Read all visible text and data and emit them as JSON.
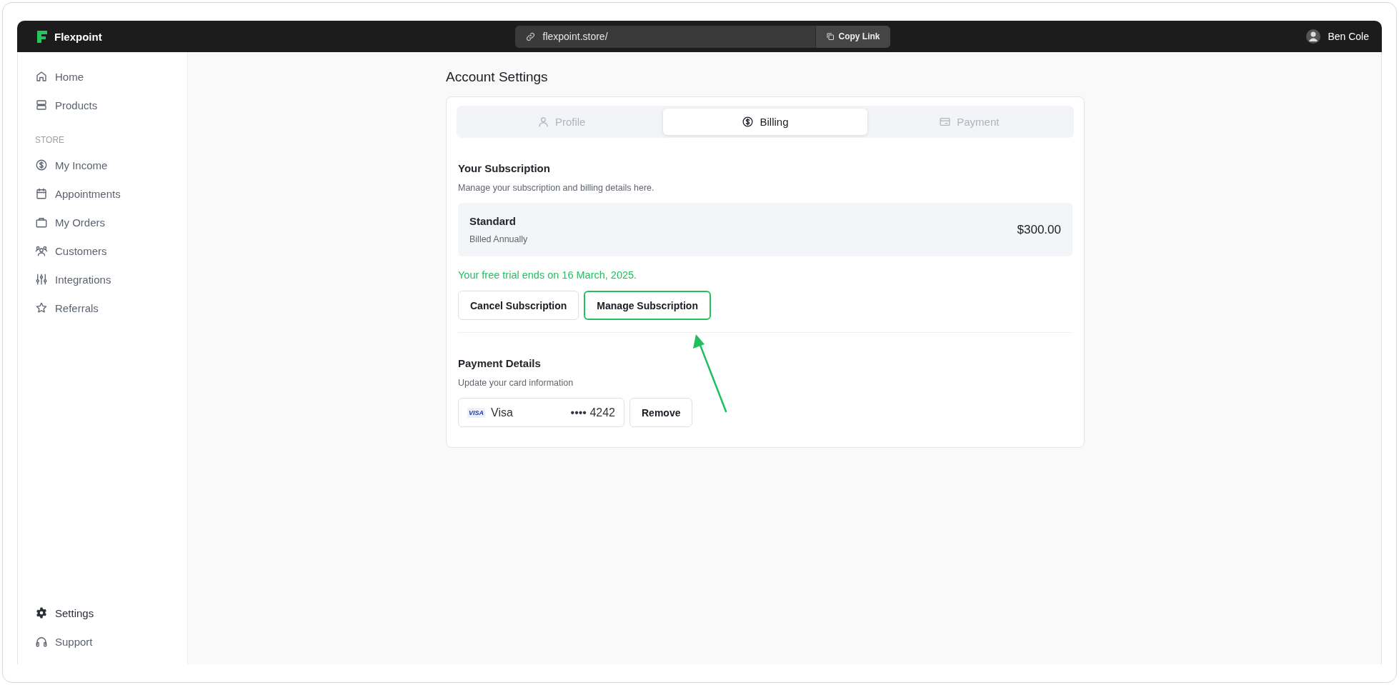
{
  "app": {
    "name": "Flexpoint"
  },
  "address_bar": {
    "url": "flexpoint.store/",
    "copy_label": "Copy Link"
  },
  "user": {
    "name": "Ben Cole"
  },
  "sidebar": {
    "items": [
      {
        "label": "Home",
        "selected": false
      },
      {
        "label": "Products",
        "selected": false
      }
    ],
    "section_label": "STORE",
    "section_items": [
      {
        "label": "My Income",
        "selected": false
      },
      {
        "label": "Appointments",
        "selected": false
      },
      {
        "label": "My Orders",
        "selected": false
      },
      {
        "label": "Customers",
        "selected": false
      },
      {
        "label": "Integrations",
        "selected": false
      },
      {
        "label": "Referrals",
        "selected": false
      }
    ],
    "footer_items": [
      {
        "label": "Settings",
        "selected": true
      },
      {
        "label": "Support",
        "selected": false
      }
    ]
  },
  "page_title": "Account Settings",
  "tabs": [
    {
      "label": "Profile",
      "selected": false
    },
    {
      "label": "Billing",
      "selected": true
    },
    {
      "label": "Payment",
      "selected": false
    }
  ],
  "subscription": {
    "title": "Your Subscription",
    "subtitle": "Manage your subscription and billing details here.",
    "plan": {
      "name": "Standard",
      "period": "Billed Annually",
      "price": "$300.00"
    },
    "trial_note": "Your free trial ends on 16 March, 2025.",
    "buttons": [
      {
        "label": "Cancel Subscription",
        "highlighted": false
      },
      {
        "label": "Manage Subscription",
        "highlighted": true
      }
    ]
  },
  "payment": {
    "title": "Payment Details",
    "subtitle": "Update your card information",
    "card": {
      "badge": "VISA",
      "brand": "Visa",
      "number": "•••• 4242"
    },
    "remove_button": "Remove"
  }
}
